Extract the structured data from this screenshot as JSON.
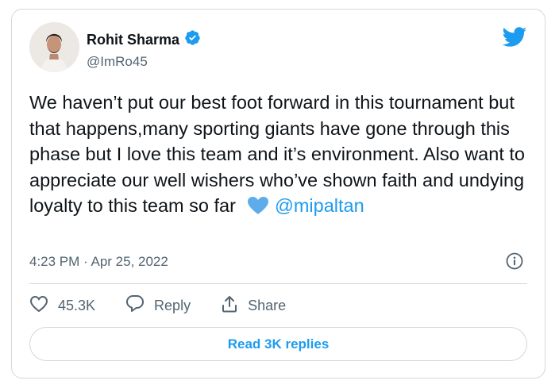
{
  "tweet": {
    "author_name": "Rohit Sharma",
    "author_handle": "@ImRo45",
    "text_main": "We haven’t put our best foot forward in this tournament but that happens,many sporting giants have gone through this phase but I love this team and it’s environment. Also want to appreciate our well wishers who’ve shown faith and undying loyalty to this team so far",
    "mention": "@mipaltan",
    "timestamp": "4:23 PM · Apr 25, 2022",
    "likes_count": "45.3K",
    "reply_label": "Reply",
    "share_label": "Share",
    "read_replies_label": "Read 3K replies"
  },
  "icons": {
    "verified": "verified-badge-icon",
    "brand": "twitter-bird-icon",
    "info": "info-icon",
    "heart": "heart-outline-icon",
    "reply": "speech-bubble-icon",
    "share": "share-upload-icon",
    "emoji": "blue-heart-emoji"
  },
  "colors": {
    "accent": "#1d9bf0",
    "text": "#0f1419",
    "muted": "#536471",
    "border": "#cfd9de",
    "heart_emoji": "#5dadec"
  }
}
